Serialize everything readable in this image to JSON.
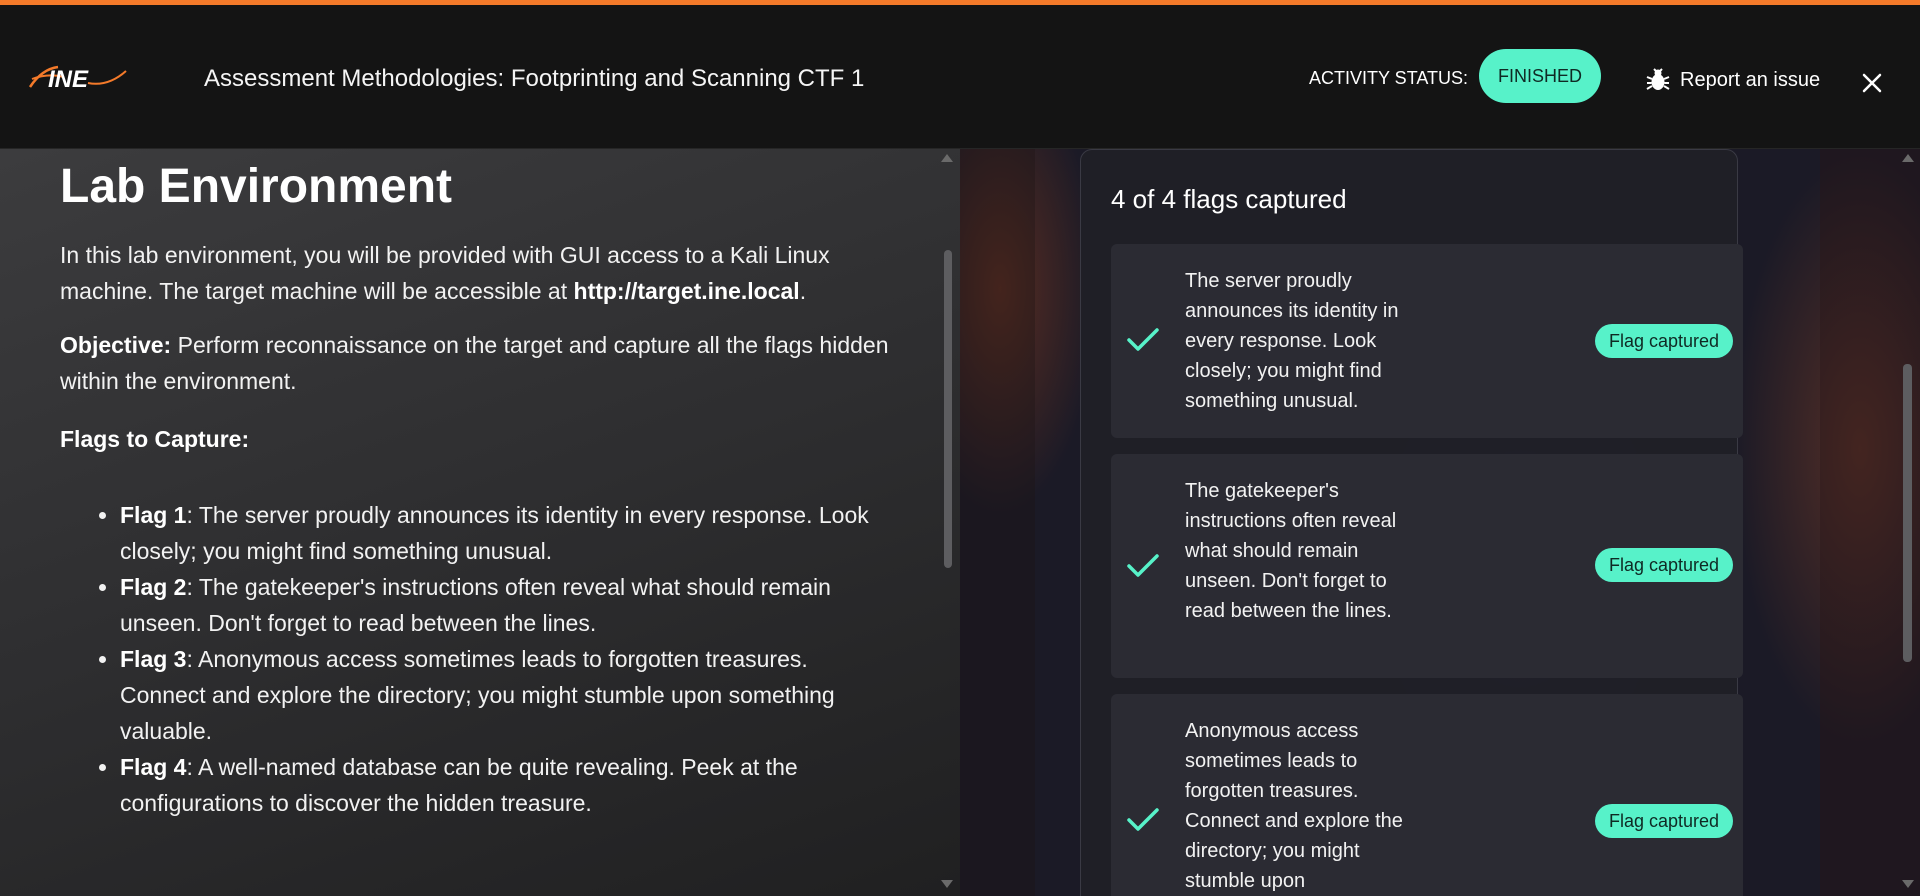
{
  "header": {
    "logo_text": "INE",
    "title": "Assessment Methodologies: Footprinting and Scanning CTF 1",
    "status_label": "ACTIVITY STATUS:",
    "status_value": "FINISHED",
    "report_label": "Report an issue",
    "accent_color": "#f47a2a",
    "status_color": "#57f2c9"
  },
  "lab": {
    "heading": "Lab Environment",
    "intro_prefix": "In this lab environment, you will be provided with GUI access to a Kali Linux machine. The target machine will be accessible at ",
    "target_url": "http://target.ine.local",
    "intro_suffix": ".",
    "objective_label": "Objective:",
    "objective_text": " Perform reconnaissance on the target and capture all the flags hidden within the environment.",
    "flags_heading": "Flags to Capture:",
    "flags": [
      {
        "label": "Flag 1",
        "sep": ":",
        "text": " The server proudly announces its identity in every response. Look closely; you might find something unusual."
      },
      {
        "label": "Flag 2",
        "sep": ":",
        "text": " The gatekeeper's instructions often reveal what should remain unseen. Don't forget to read between the lines."
      },
      {
        "label": "Flag 3",
        "sep": ":",
        "text": " Anonymous access sometimes leads to forgotten treasures. Connect and explore the directory; you might stumble upon something valuable."
      },
      {
        "label": "Flag 4",
        "sep": ":",
        "text": " A well-named database can be quite revealing. Peek at the configurations to discover the hidden treasure."
      }
    ]
  },
  "flags_panel": {
    "count_text": "4 of 4 flags captured",
    "cards": [
      {
        "text": "The server proudly announces its identity in every response. Look closely; you might find something unusual.",
        "badge": "Flag captured",
        "icon": "check-icon"
      },
      {
        "text": "The gatekeeper's instructions often reveal what should remain unseen. Don't forget to read between the lines.",
        "badge": "Flag captured",
        "icon": "check-icon"
      },
      {
        "text": "Anonymous access sometimes leads to forgotten treasures. Connect and explore the directory; you might stumble upon",
        "badge": "Flag captured",
        "icon": "check-icon"
      }
    ]
  }
}
